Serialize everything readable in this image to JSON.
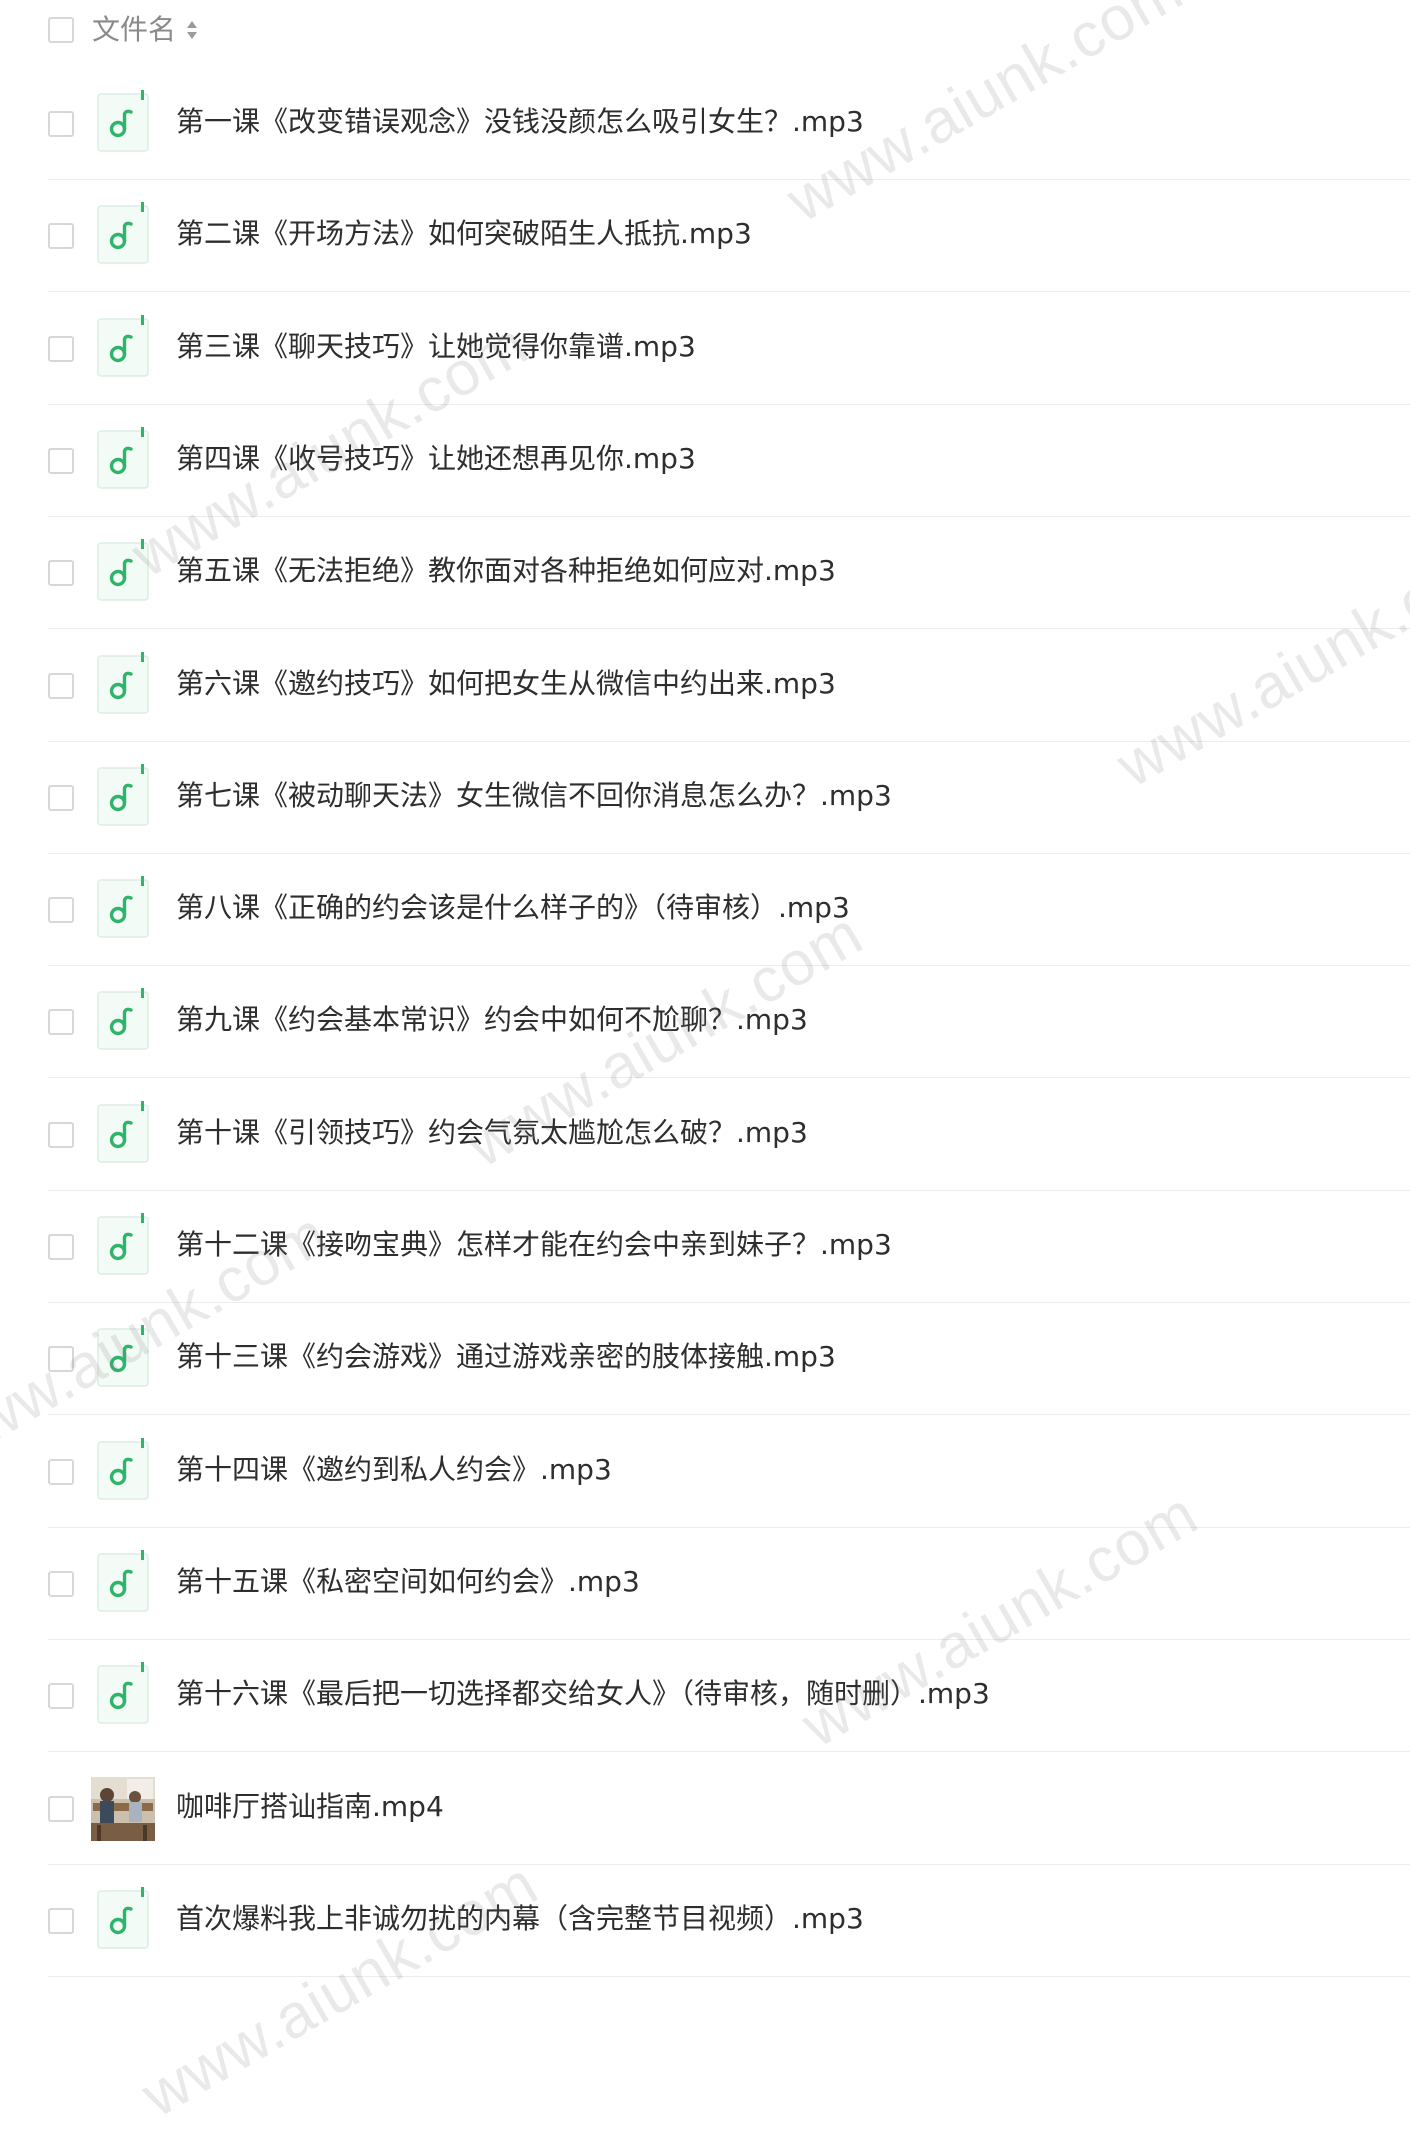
{
  "header": {
    "column_label": "文件名"
  },
  "watermark_text": "www.aiunk.com",
  "files": [
    {
      "name": "第一课《改变错误观念》没钱没颜怎么吸引女生？.mp3",
      "type": "audio"
    },
    {
      "name": "第二课《开场方法》如何突破陌生人抵抗.mp3",
      "type": "audio"
    },
    {
      "name": "第三课《聊天技巧》让她觉得你靠谱.mp3",
      "type": "audio"
    },
    {
      "name": "第四课《收号技巧》让她还想再见你.mp3",
      "type": "audio"
    },
    {
      "name": "第五课《无法拒绝》教你面对各种拒绝如何应对.mp3",
      "type": "audio"
    },
    {
      "name": "第六课《邀约技巧》如何把女生从微信中约出来.mp3",
      "type": "audio"
    },
    {
      "name": "第七课《被动聊天法》女生微信不回你消息怎么办？.mp3",
      "type": "audio"
    },
    {
      "name": "第八课《正确的约会该是什么样子的》（待审核）.mp3",
      "type": "audio"
    },
    {
      "name": "第九课《约会基本常识》约会中如何不尬聊？.mp3",
      "type": "audio"
    },
    {
      "name": "第十课《引领技巧》约会气氛太尴尬怎么破？.mp3",
      "type": "audio"
    },
    {
      "name": "第十二课《接吻宝典》怎样才能在约会中亲到妹子？.mp3",
      "type": "audio"
    },
    {
      "name": "第十三课《约会游戏》通过游戏亲密的肢体接触.mp3",
      "type": "audio"
    },
    {
      "name": "第十四课《邀约到私人约会》.mp3",
      "type": "audio"
    },
    {
      "name": "第十五课《私密空间如何约会》.mp3",
      "type": "audio"
    },
    {
      "name": "第十六课《最后把一切选择都交给女人》（待审核，随时删）.mp3",
      "type": "audio"
    },
    {
      "name": "咖啡厅搭讪指南.mp4",
      "type": "video"
    },
    {
      "name": "首次爆料我上非诚勿扰的内幕（含完整节目视频）.mp3",
      "type": "audio"
    }
  ]
}
